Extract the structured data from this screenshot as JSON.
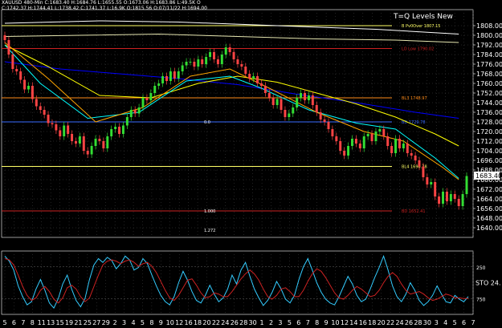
{
  "header": {
    "symbol_line": "XAUUSD 480-Min  C:1683.40  H:1684.76  L:1655.55  O:1673.06  H:1683.86  L:49.5K  O",
    "indicator_line": "C:1742.37  H:1744.41  L:1738.42  C:1741.37  L:16.9K  O:1815.56  O:07/11/22  H:1694.00"
  },
  "title": "T=Q Levels New",
  "chart_data": {
    "type": "line",
    "title": "T=Q Levels New",
    "xlabel": "",
    "ylabel": "",
    "ylim": [
      1632,
      1812
    ],
    "y_ticks": [
      1808,
      1800,
      1792,
      1784,
      1776,
      1768,
      1760,
      1752,
      1744,
      1736,
      1728,
      1720,
      1712,
      1704,
      1696,
      1688,
      1680,
      1672,
      1664,
      1656,
      1648,
      1640
    ],
    "x_ticks": [
      "5",
      "6",
      "7",
      "8",
      "11",
      "13",
      "15",
      "19",
      "21",
      "25",
      "27",
      "29",
      "2",
      "3",
      "4",
      "5",
      "8",
      "9",
      "10",
      "12",
      "16",
      "18",
      "20",
      "22",
      "24",
      "26",
      "28",
      "30",
      "1",
      "2",
      "3",
      "5",
      "6",
      "7",
      "8",
      "9",
      "10",
      "12",
      "14",
      "16",
      "18",
      "20",
      "22",
      "24",
      "26",
      "28",
      "30",
      "3",
      "4",
      "5",
      "6",
      "7"
    ],
    "last_price": "1683.40",
    "close_series": [
      1796,
      1784,
      1772,
      1770,
      1763,
      1755,
      1758,
      1747,
      1741,
      1738,
      1734,
      1727,
      1726,
      1721,
      1716,
      1725,
      1718,
      1712,
      1710,
      1716,
      1704,
      1701,
      1708,
      1714,
      1712,
      1706,
      1716,
      1722,
      1724,
      1718,
      1725,
      1732,
      1738,
      1735,
      1740,
      1748,
      1746,
      1752,
      1758,
      1760,
      1766,
      1762,
      1770,
      1764,
      1770,
      1775,
      1778,
      1778,
      1774,
      1780,
      1776,
      1782,
      1786,
      1780,
      1776,
      1784,
      1790,
      1786,
      1780,
      1776,
      1774,
      1768,
      1764,
      1766,
      1760,
      1758,
      1752,
      1748,
      1742,
      1747,
      1738,
      1732,
      1735,
      1740,
      1748,
      1752,
      1746,
      1750,
      1742,
      1736,
      1730,
      1728,
      1722,
      1716,
      1712,
      1704,
      1700,
      1708,
      1714,
      1710,
      1706,
      1716,
      1718,
      1712,
      1720,
      1722,
      1716,
      1708,
      1702,
      1714,
      1706,
      1710,
      1702,
      1700,
      1696,
      1691,
      1682,
      1676,
      1678,
      1666,
      1660,
      1670,
      1662,
      1668,
      1664,
      1658,
      1668,
      1683
    ],
    "ma_series": [
      {
        "color": "#ffffff",
        "values": [
          [
            1,
            1810
          ],
          [
            25,
            1812
          ],
          [
            45,
            1811
          ],
          [
            70,
            1808
          ],
          [
            95,
            1805
          ],
          [
            116,
            1801
          ]
        ]
      },
      {
        "color": "#e6e6b0",
        "values": [
          [
            1,
            1799
          ],
          [
            20,
            1800
          ],
          [
            40,
            1801
          ],
          [
            60,
            1799
          ],
          [
            80,
            1797
          ],
          [
            100,
            1796
          ],
          [
            116,
            1794
          ]
        ]
      },
      {
        "color": "#0000ff",
        "values": [
          [
            1,
            1778
          ],
          [
            15,
            1772
          ],
          [
            30,
            1768
          ],
          [
            45,
            1764
          ],
          [
            60,
            1759
          ],
          [
            75,
            1751
          ],
          [
            90,
            1744
          ],
          [
            105,
            1736
          ],
          [
            116,
            1731
          ]
        ]
      },
      {
        "color": "#ffff00",
        "values": [
          [
            1,
            1792
          ],
          [
            12,
            1774
          ],
          [
            25,
            1750
          ],
          [
            38,
            1748
          ],
          [
            50,
            1760
          ],
          [
            60,
            1766
          ],
          [
            70,
            1761
          ],
          [
            80,
            1752
          ],
          [
            90,
            1743
          ],
          [
            100,
            1732
          ],
          [
            110,
            1718
          ],
          [
            116,
            1708
          ]
        ]
      },
      {
        "color": "#00ffff",
        "values": [
          [
            1,
            1792
          ],
          [
            10,
            1760
          ],
          [
            22,
            1731
          ],
          [
            35,
            1736
          ],
          [
            47,
            1762
          ],
          [
            58,
            1766
          ],
          [
            66,
            1756
          ],
          [
            78,
            1738
          ],
          [
            90,
            1727
          ],
          [
            100,
            1722
          ],
          [
            110,
            1698
          ],
          [
            116,
            1681
          ]
        ]
      },
      {
        "color": "#ffa500",
        "values": [
          [
            1,
            1794
          ],
          [
            12,
            1764
          ],
          [
            24,
            1728
          ],
          [
            36,
            1740
          ],
          [
            48,
            1766
          ],
          [
            58,
            1772
          ],
          [
            68,
            1756
          ],
          [
            80,
            1736
          ],
          [
            92,
            1720
          ],
          [
            102,
            1712
          ],
          [
            112,
            1690
          ],
          [
            116,
            1680
          ]
        ]
      }
    ],
    "levels": [
      {
        "value": 1808,
        "label": "B Pv0Over 1807.15",
        "color": "#ffff66"
      },
      {
        "value": 1789,
        "label": "LO Low 1790.02",
        "color": "#cc2222"
      },
      {
        "value": 1748,
        "label": "BL3 1748.97",
        "color": "#ff8c1a"
      },
      {
        "value": 1728,
        "label": "BD 1729.78",
        "color": "#3a6cff"
      },
      {
        "value": 1691,
        "label": "BL4 1690.78",
        "color": "#ffff66"
      },
      {
        "value": 1654,
        "label": "BD 1652.41",
        "color": "#cc2222"
      }
    ],
    "fib_labels": [
      "0.0",
      "1.000",
      "1.272"
    ],
    "stoch": {
      "label": "STO",
      "value": "24.",
      "ylim": [
        0,
        100
      ],
      "y_ticks": [
        "250",
        "750"
      ],
      "k_values": [
        92,
        84,
        70,
        45,
        28,
        15,
        20,
        40,
        55,
        38,
        18,
        10,
        25,
        48,
        62,
        40,
        22,
        12,
        25,
        55,
        78,
        88,
        82,
        90,
        85,
        72,
        80,
        92,
        86,
        70,
        74,
        88,
        80,
        62,
        45,
        30,
        20,
        15,
        28,
        50,
        68,
        54,
        36,
        22,
        18,
        30,
        46,
        32,
        20,
        26,
        40,
        62,
        48,
        70,
        82,
        60,
        40,
        26,
        14,
        22,
        35,
        52,
        40,
        24,
        18,
        30,
        55,
        75,
        88,
        70,
        50,
        35,
        24,
        18,
        15,
        28,
        44,
        60,
        48,
        30,
        20,
        24,
        40,
        58,
        74,
        92,
        70,
        45,
        28,
        20,
        32,
        50,
        38,
        22,
        14,
        20,
        30,
        45,
        32,
        20,
        18,
        30,
        24,
        20,
        28
      ],
      "d_values": [
        88,
        86,
        78,
        62,
        44,
        30,
        22,
        26,
        38,
        44,
        36,
        24,
        18,
        26,
        42,
        46,
        40,
        28,
        20,
        26,
        44,
        62,
        78,
        84,
        86,
        84,
        80,
        84,
        86,
        82,
        76,
        80,
        82,
        76,
        66,
        52,
        38,
        26,
        22,
        30,
        42,
        54,
        56,
        46,
        34,
        26,
        28,
        34,
        32,
        28,
        28,
        36,
        46,
        56,
        64,
        70,
        64,
        54,
        40,
        28,
        24,
        30,
        40,
        42,
        36,
        28,
        28,
        38,
        52,
        64,
        72,
        68,
        58,
        46,
        34,
        26,
        24,
        30,
        38,
        44,
        40,
        34,
        28,
        30,
        38,
        50,
        60,
        66,
        60,
        48,
        38,
        32,
        34,
        36,
        32,
        26,
        22,
        24,
        28,
        32,
        30,
        26,
        26,
        25,
        25
      ]
    }
  }
}
